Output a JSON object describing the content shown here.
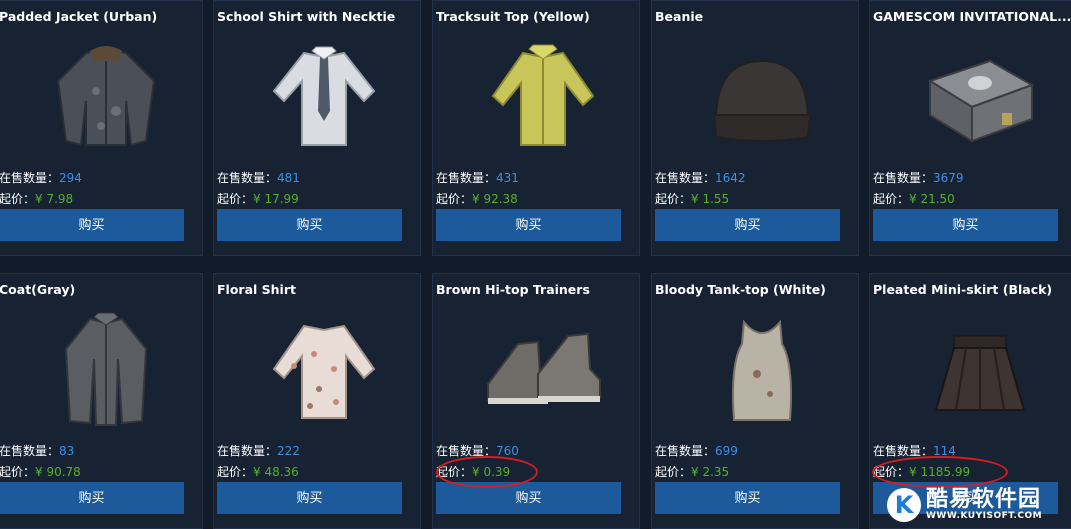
{
  "labels": {
    "count_label": "在售数量：",
    "price_label": "起价：",
    "buy": "购买"
  },
  "items": [
    {
      "name": "Padded Jacket (Urban)",
      "count": "294",
      "price": "¥ 7.98",
      "icon": "padded-jacket-icon"
    },
    {
      "name": "School Shirt with Necktie",
      "count": "481",
      "price": "¥ 17.99",
      "icon": "school-shirt-icon"
    },
    {
      "name": "Tracksuit Top (Yellow)",
      "count": "431",
      "price": "¥ 92.38",
      "icon": "tracksuit-top-icon"
    },
    {
      "name": "Beanie",
      "count": "1642",
      "price": "¥ 1.55",
      "icon": "beanie-icon"
    },
    {
      "name": "GAMESCOM INVITATIONAL...",
      "count": "3679",
      "price": "¥ 21.50",
      "icon": "crate-icon"
    },
    {
      "name": "Coat(Gray)",
      "count": "83",
      "price": "¥ 90.78",
      "icon": "coat-icon"
    },
    {
      "name": "Floral Shirt",
      "count": "222",
      "price": "¥ 48.36",
      "icon": "floral-shirt-icon"
    },
    {
      "name": "Brown Hi-top Trainers",
      "count": "760",
      "price": "¥ 0.39",
      "icon": "trainers-icon"
    },
    {
      "name": "Bloody Tank-top (White)",
      "count": "699",
      "price": "¥ 2.35",
      "icon": "tank-top-icon"
    },
    {
      "name": "Pleated Mini-skirt (Black)",
      "count": "114",
      "price": "¥ 1185.99",
      "icon": "skirt-icon"
    }
  ],
  "watermark": {
    "cn": "酷易软件园",
    "en": "WWW.KUYISOFT.COM",
    "logo": "K"
  },
  "colors": {
    "background": "#111b29",
    "card": "#172233",
    "button": "#1c5a9c",
    "count": "#3d8fe6",
    "price": "#58b226",
    "highlight": "#d91c1c"
  }
}
